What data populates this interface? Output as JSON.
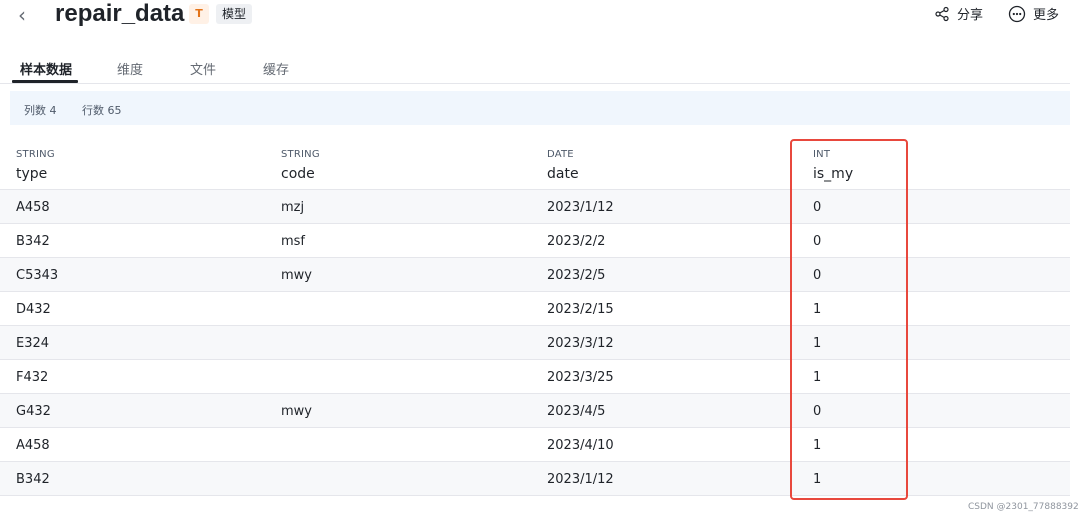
{
  "header": {
    "back_icon": "chevron-left-icon",
    "title": "repair_data",
    "type_badge": "T",
    "model_badge": "模型",
    "share_label": "分享",
    "more_label": "更多"
  },
  "tabs": [
    {
      "label": "样本数据",
      "active": true
    },
    {
      "label": "维度",
      "active": false
    },
    {
      "label": "文件",
      "active": false
    },
    {
      "label": "缓存",
      "active": false
    }
  ],
  "info": {
    "columns": "列数 4",
    "rows": "行数 65"
  },
  "table": {
    "columns": [
      {
        "type": "STRING",
        "name": "type"
      },
      {
        "type": "STRING",
        "name": "code"
      },
      {
        "type": "DATE",
        "name": "date"
      },
      {
        "type": "INT",
        "name": "is_my"
      }
    ],
    "rows": [
      [
        "A458",
        "mzj",
        "2023/1/12",
        "0"
      ],
      [
        "B342",
        "msf",
        "2023/2/2",
        "0"
      ],
      [
        "C5343",
        "mwy",
        "2023/2/5",
        "0"
      ],
      [
        "D432",
        "",
        "2023/2/15",
        "1"
      ],
      [
        "E324",
        "",
        "2023/3/12",
        "1"
      ],
      [
        "F432",
        "",
        "2023/3/25",
        "1"
      ],
      [
        "G432",
        "mwy",
        "2023/4/5",
        "0"
      ],
      [
        "A458",
        "",
        "2023/4/10",
        "1"
      ],
      [
        "B342",
        "",
        "2023/1/12",
        "1"
      ]
    ]
  },
  "colors": {
    "highlight": "#e8483d",
    "info_bg": "#f0f6fd",
    "row_alt": "#f7f8fa"
  },
  "watermark": "CSDN @2301_77888392"
}
